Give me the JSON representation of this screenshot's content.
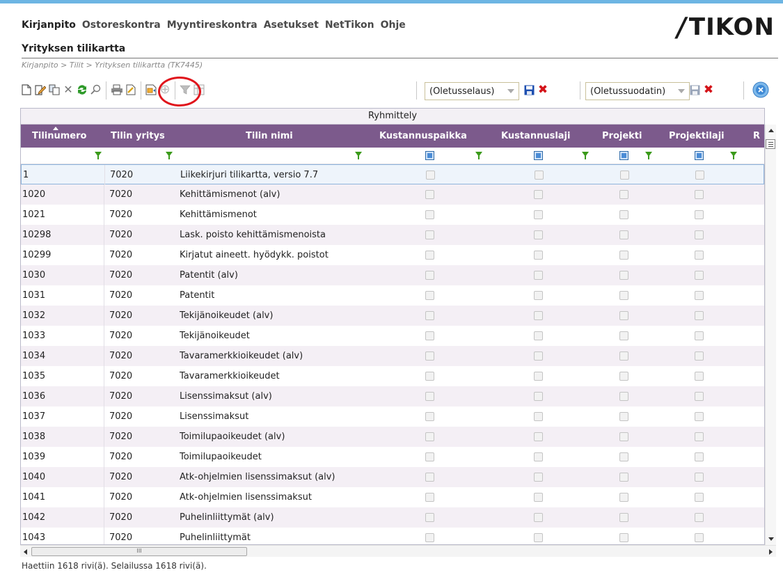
{
  "menu": [
    "Kirjanpito",
    "Ostoreskontra",
    "Myyntireskontra",
    "Asetukset",
    "NetTikon",
    "Ohje"
  ],
  "logo": {
    "slash": "/",
    "text": "TIKON"
  },
  "page_title": "Yrityksen tilikartta",
  "breadcrumb": "Kirjanpito > Tilit > Yrityksen tilikartta  (TK7445)",
  "toolbar": {
    "icons": [
      "new-document-icon",
      "edit-icon",
      "copy-icon",
      "delete-icon",
      "refresh-icon",
      "search-icon",
      "print-icon",
      "export-icon",
      "group-icon",
      "ungroup-icon",
      "filter-icon",
      "layout-icon"
    ],
    "view_select": "(Oletusselaus)",
    "filter_select": "(Oletussuodatin)"
  },
  "colors": {
    "header": "#7c5a8c",
    "accent": "#6db5e3",
    "highlight_ring": "#e0141c",
    "filter_funnel": "#3a9a1a"
  },
  "grid": {
    "group_label": "Ryhmittely",
    "columns": [
      "Tilinumero",
      "Tilin yritys",
      "Tilin nimi",
      "Kustannuspaikka",
      "Kustannuslaji",
      "Projekti",
      "Projektilaji",
      "R"
    ],
    "rows": [
      {
        "num": "1",
        "company": "7020",
        "name": "Liikekirjuri tilikartta, versio 7.7"
      },
      {
        "num": "1020",
        "company": "7020",
        "name": "Kehittämismenot (alv)"
      },
      {
        "num": "1021",
        "company": "7020",
        "name": "Kehittämismenot"
      },
      {
        "num": "10298",
        "company": "7020",
        "name": "Lask. poisto kehittämismenoista"
      },
      {
        "num": "10299",
        "company": "7020",
        "name": "Kirjatut aineett. hyödykk. poistot"
      },
      {
        "num": "1030",
        "company": "7020",
        "name": "Patentit (alv)"
      },
      {
        "num": "1031",
        "company": "7020",
        "name": "Patentit"
      },
      {
        "num": "1032",
        "company": "7020",
        "name": "Tekijänoikeudet (alv)"
      },
      {
        "num": "1033",
        "company": "7020",
        "name": "Tekijänoikeudet"
      },
      {
        "num": "1034",
        "company": "7020",
        "name": "Tavaramerkkioikeudet (alv)"
      },
      {
        "num": "1035",
        "company": "7020",
        "name": "Tavaramerkkioikeudet"
      },
      {
        "num": "1036",
        "company": "7020",
        "name": "Lisenssimaksut (alv)"
      },
      {
        "num": "1037",
        "company": "7020",
        "name": "Lisenssimaksut"
      },
      {
        "num": "1038",
        "company": "7020",
        "name": "Toimilupaoikeudet (alv)"
      },
      {
        "num": "1039",
        "company": "7020",
        "name": "Toimilupaoikeudet"
      },
      {
        "num": "1040",
        "company": "7020",
        "name": "Atk-ohjelmien lisenssimaksut (alv)"
      },
      {
        "num": "1041",
        "company": "7020",
        "name": "Atk-ohjelmien lisenssimaksut"
      },
      {
        "num": "1042",
        "company": "7020",
        "name": "Puhelinliittymät (alv)"
      },
      {
        "num": "1043",
        "company": "7020",
        "name": "Puhelinliittymät"
      }
    ],
    "scroll_grip": "III"
  },
  "status_text": "Haettiin 1618 rivi(ä). Selailussa 1618 rivi(ä)."
}
